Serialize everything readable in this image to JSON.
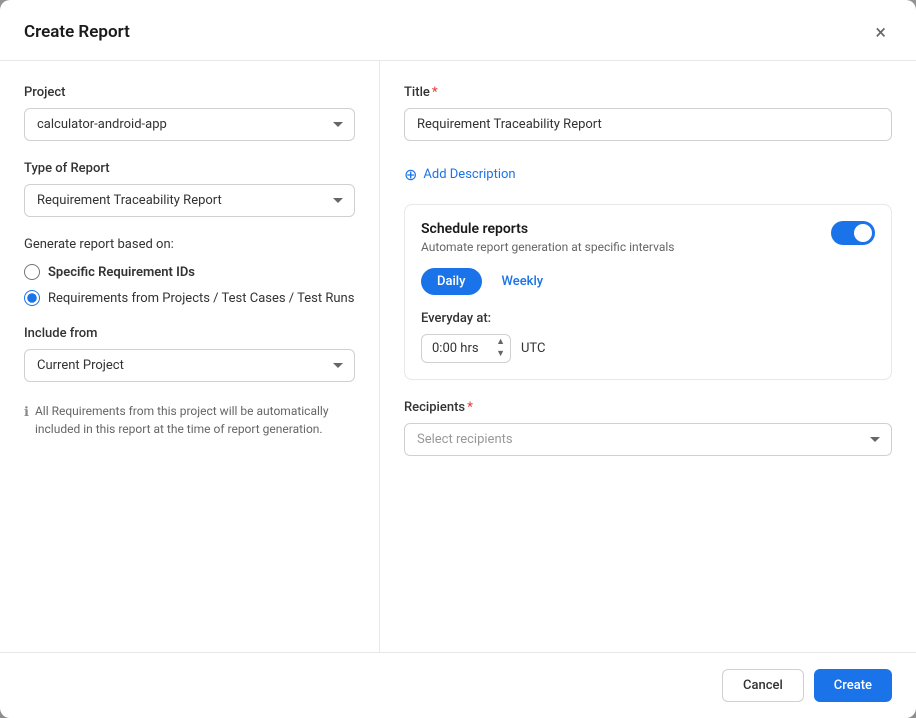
{
  "dialog": {
    "title": "Create Report",
    "close_label": "×"
  },
  "left": {
    "project_label": "Project",
    "project_value": "calculator-android-app",
    "report_type_label": "Type of Report",
    "report_type_value": "Requirement Traceability Report",
    "generate_label": "Generate report based on:",
    "radio_options": [
      {
        "id": "specific",
        "label": "Specific Requirement IDs",
        "bold": true,
        "checked": false
      },
      {
        "id": "requirements",
        "label": "Requirements from Projects / Test Cases / Test Runs",
        "bold": false,
        "checked": true
      }
    ],
    "include_from_label": "Include from",
    "include_from_value": "Current Project",
    "info_text": "All Requirements from this project will be automatically included in this report at the time of report generation."
  },
  "right": {
    "title_label": "Title",
    "title_required": true,
    "title_value": "Requirement Traceability Report",
    "add_description_label": "Add Description",
    "schedule": {
      "title": "Schedule reports",
      "description": "Automate report generation at specific intervals",
      "toggle_on": true,
      "tabs": [
        {
          "id": "daily",
          "label": "Daily",
          "active": true
        },
        {
          "id": "weekly",
          "label": "Weekly",
          "active": false
        }
      ],
      "everyday_label": "Everyday at:",
      "time_value": "0:00 hrs",
      "timezone": "UTC"
    },
    "recipients_label": "Recipients",
    "recipients_required": true,
    "recipients_placeholder": "Select recipients"
  },
  "footer": {
    "cancel_label": "Cancel",
    "create_label": "Create"
  }
}
